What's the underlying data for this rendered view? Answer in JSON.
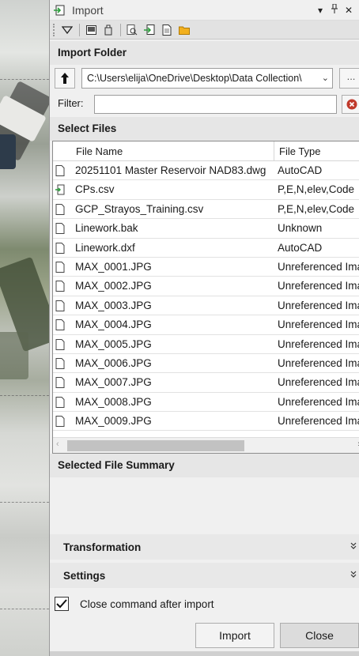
{
  "window": {
    "title": "Import"
  },
  "titlebar_buttons": [
    "menu-caret",
    "pin",
    "close"
  ],
  "toolbar_icons": [
    "dropdown-triangle-icon",
    "view-icon",
    "usb-drive-icon",
    "search-document-icon",
    "import-file-icon",
    "document-icon",
    "folder-icon"
  ],
  "import_folder": {
    "heading": "Import Folder",
    "path": "C:\\Users\\elija\\OneDrive\\Desktop\\Data Collection\\",
    "browse_label": "..."
  },
  "filter": {
    "label": "Filter:",
    "value": ""
  },
  "select_files": {
    "heading": "Select Files",
    "columns": [
      "File Name",
      "File Type"
    ],
    "rows": [
      {
        "name": "20251101 Master Reservoir NAD83.dwg",
        "type": "AutoCAD",
        "icon": "document-icon"
      },
      {
        "name": "CPs.csv",
        "type": "P,E,N,elev,Code",
        "icon": "point-file-icon"
      },
      {
        "name": "GCP_Strayos_Training.csv",
        "type": "P,E,N,elev,Code",
        "icon": "document-icon"
      },
      {
        "name": "Linework.bak",
        "type": "Unknown",
        "icon": "document-icon"
      },
      {
        "name": "Linework.dxf",
        "type": "AutoCAD",
        "icon": "document-icon"
      },
      {
        "name": "MAX_0001.JPG",
        "type": "Unreferenced Ima",
        "icon": "document-icon"
      },
      {
        "name": "MAX_0002.JPG",
        "type": "Unreferenced Ima",
        "icon": "document-icon"
      },
      {
        "name": "MAX_0003.JPG",
        "type": "Unreferenced Ima",
        "icon": "document-icon"
      },
      {
        "name": "MAX_0004.JPG",
        "type": "Unreferenced Ima",
        "icon": "document-icon"
      },
      {
        "name": "MAX_0005.JPG",
        "type": "Unreferenced Ima",
        "icon": "document-icon"
      },
      {
        "name": "MAX_0006.JPG",
        "type": "Unreferenced Ima",
        "icon": "document-icon"
      },
      {
        "name": "MAX_0007.JPG",
        "type": "Unreferenced Ima",
        "icon": "document-icon"
      },
      {
        "name": "MAX_0008.JPG",
        "type": "Unreferenced Ima",
        "icon": "document-icon"
      },
      {
        "name": "MAX_0009.JPG",
        "type": "Unreferenced Ima",
        "icon": "document-icon"
      }
    ]
  },
  "summary": {
    "heading": "Selected File Summary"
  },
  "transformation": {
    "label": "Transformation",
    "state": "collapsed"
  },
  "settings": {
    "label": "Settings",
    "state": "collapsed"
  },
  "close_after_import": {
    "label": "Close command after import",
    "checked": true
  },
  "buttons": {
    "import": "Import",
    "close": "Close"
  },
  "colors": {
    "panel_bg": "#f0f0f0",
    "section_bg": "#e6e6e6",
    "clear_red": "#c0392b",
    "folder_yellow": "#f2b01e"
  }
}
